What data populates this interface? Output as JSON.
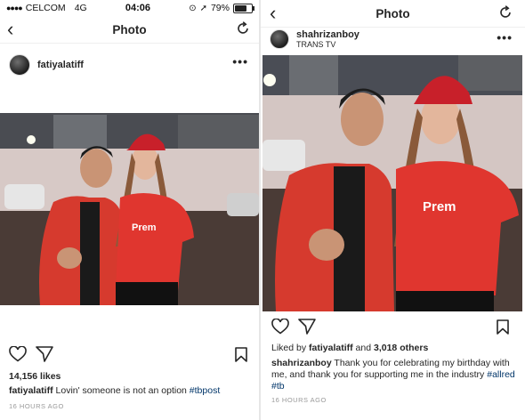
{
  "left": {
    "status": {
      "carrier": "CELCOM",
      "network": "4G",
      "time": "04:06"
    },
    "nav": {
      "title": "Photo"
    },
    "post": {
      "username": "fatiyalatiff",
      "likes": "14,156 likes",
      "caption_user": "fatiyalatiff",
      "caption_text": "Lovin' someone is not an option",
      "caption_tag": "#tbpost",
      "timestamp": "16 HOURS AGO"
    }
  },
  "right": {
    "nav": {
      "title": "Photo"
    },
    "post": {
      "username": "shahrizanboy",
      "location": "TRANS TV",
      "liked_prefix": "Liked by",
      "liked_user": "fatiyalatiff",
      "liked_and": "and",
      "liked_others": "3,018 others",
      "caption_user": "shahrizanboy",
      "caption_text": "Thank you for celebrating my birthday with me, and thank you for supporting me in the industry",
      "caption_tags": "#allred #tb",
      "timestamp": "16 HOURS AGO"
    }
  },
  "battery_percent": "79%",
  "battery_level": 0.79,
  "shirt_text": "Prem",
  "icons": [
    "back-chevron-icon",
    "refresh-icon",
    "more-options-icon",
    "heart-icon",
    "share-icon",
    "bookmark-icon",
    "location-arrow-icon",
    "lock-rotation-icon",
    "battery-icon"
  ],
  "colors": {
    "shirt_red": "#e0362f",
    "cap_red": "#c8202a",
    "tag_blue": "#003569"
  }
}
